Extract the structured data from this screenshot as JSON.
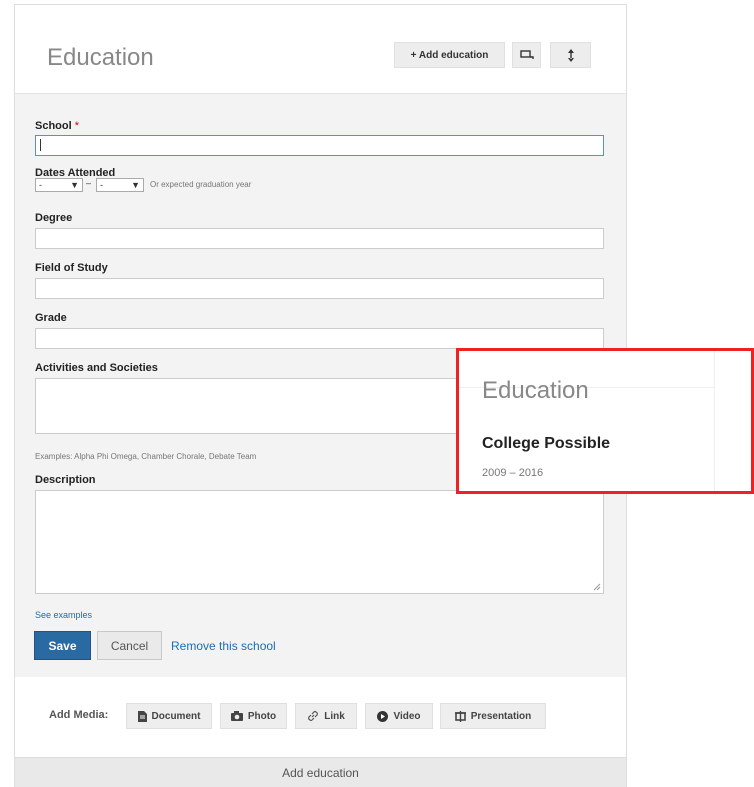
{
  "header": {
    "title": "Education",
    "add_button": "+ Add education"
  },
  "form": {
    "school_label": "School",
    "required_mark": "*",
    "school_value": "",
    "dates_label": "Dates Attended",
    "date_from": "-",
    "date_sep": "–",
    "date_to": "-",
    "dates_hint": "Or expected graduation year",
    "degree_label": "Degree",
    "field_label": "Field of Study",
    "grade_label": "Grade",
    "activities_label": "Activities and Societies",
    "activities_hint": "Examples: Alpha Phi Omega, Chamber Chorale, Debate Team",
    "description_label": "Description",
    "see_examples": "See examples",
    "save": "Save",
    "cancel": "Cancel",
    "remove": "Remove this school"
  },
  "media": {
    "label": "Add Media:",
    "buttons": [
      "Document",
      "Photo",
      "Link",
      "Video",
      "Presentation"
    ]
  },
  "footer": {
    "add_education": "Add education"
  },
  "callout": {
    "title": "Education",
    "school": "College Possible",
    "dates": "2009 – 2016",
    "border_color": "#e22222"
  },
  "colors": {
    "save_button": "#2a6aa3",
    "link": "#1a6db5"
  }
}
